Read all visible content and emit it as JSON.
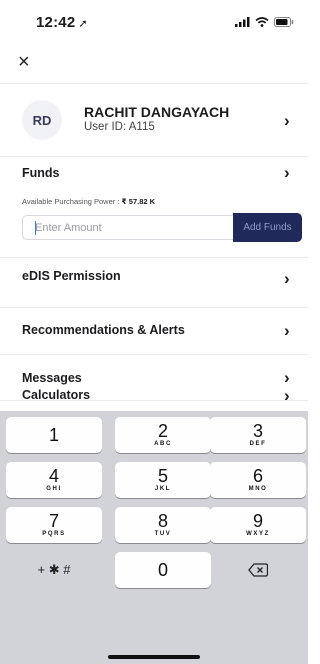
{
  "status_bar": {
    "time": "12:42",
    "location_icon": "location-arrow-icon"
  },
  "close_icon": "×",
  "profile": {
    "initials": "RD",
    "name": "RACHIT DANGAYACH",
    "user_id": "User ID: A115"
  },
  "chevron": "›",
  "funds": {
    "title": "Funds",
    "power_label": "Available Purchasing Power : ",
    "power_value": "₹ 57.82 K",
    "amount_placeholder": "Enter Amount",
    "add_button": "Add Funds"
  },
  "menu": {
    "edis": "eDIS Permission",
    "recommendations": "Recommendations & Alerts",
    "messages": "Messages",
    "calculators": "Calculators"
  },
  "keypad": {
    "keys": [
      {
        "digit": "1",
        "letters": ""
      },
      {
        "digit": "2",
        "letters": "ABC"
      },
      {
        "digit": "3",
        "letters": "DEF"
      },
      {
        "digit": "4",
        "letters": "GHI"
      },
      {
        "digit": "5",
        "letters": "JKL"
      },
      {
        "digit": "6",
        "letters": "MNO"
      },
      {
        "digit": "7",
        "letters": "PQRS"
      },
      {
        "digit": "8",
        "letters": "TUV"
      },
      {
        "digit": "9",
        "letters": "WXYZ"
      }
    ],
    "symbols": "+ ✱ #",
    "zero": "0"
  },
  "colors": {
    "accent_button": "#1f2a5a",
    "keyboard_bg": "#d1d3d9"
  }
}
